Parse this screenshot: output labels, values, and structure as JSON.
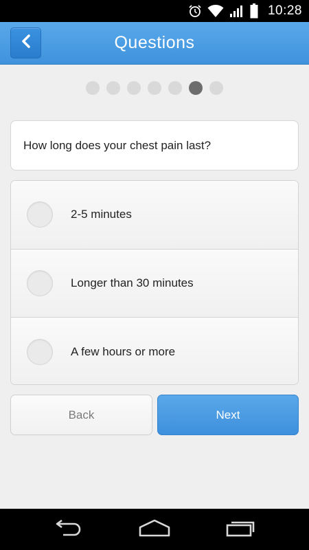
{
  "status_bar": {
    "time": "10:28",
    "icons": [
      "alarm-icon",
      "wifi-icon",
      "signal-icon",
      "battery-icon"
    ]
  },
  "header": {
    "title": "Questions",
    "back_icon": "chevron-left-icon"
  },
  "progress": {
    "total_steps": 7,
    "current_step": 6
  },
  "question": {
    "text": "How long does your chest pain last?"
  },
  "options": [
    {
      "label": "2-5 minutes",
      "selected": false
    },
    {
      "label": "Longer than 30 minutes",
      "selected": false
    },
    {
      "label": "A few hours or more",
      "selected": false
    }
  ],
  "actions": {
    "back_label": "Back",
    "next_label": "Next"
  },
  "nav_bar": {
    "icons": [
      "back-nav-icon",
      "home-nav-icon",
      "recent-apps-icon"
    ]
  },
  "colors": {
    "accent": "#4a9ee4",
    "background": "#efeff0"
  }
}
